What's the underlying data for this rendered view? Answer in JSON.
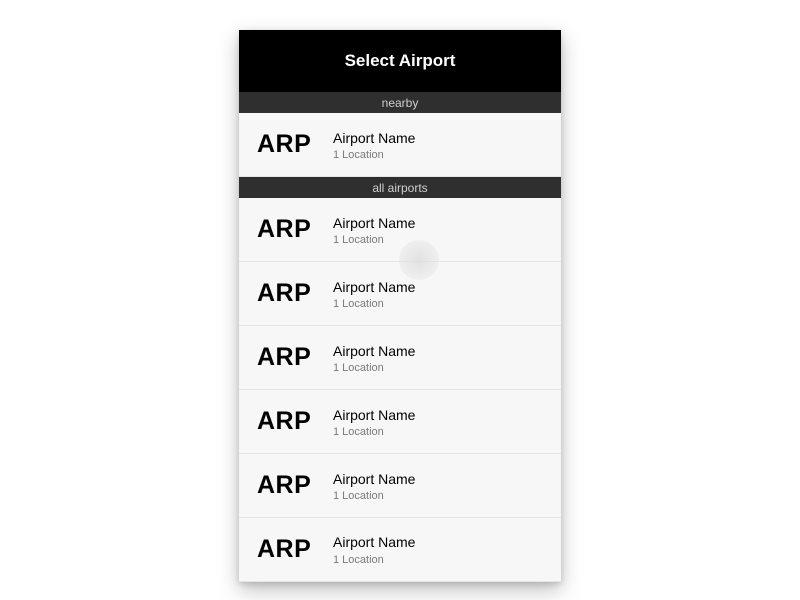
{
  "header": {
    "title": "Select Airport"
  },
  "sections": {
    "nearby": {
      "label": "nearby",
      "items": [
        {
          "code": "ARP",
          "name": "Airport Name",
          "location": "1 Location"
        }
      ]
    },
    "all": {
      "label": "all airports",
      "items": [
        {
          "code": "ARP",
          "name": "Airport Name",
          "location": "1 Location"
        },
        {
          "code": "ARP",
          "name": "Airport Name",
          "location": "1 Location"
        },
        {
          "code": "ARP",
          "name": "Airport Name",
          "location": "1 Location"
        },
        {
          "code": "ARP",
          "name": "Airport Name",
          "location": "1 Location"
        },
        {
          "code": "ARP",
          "name": "Airport Name",
          "location": "1 Location"
        },
        {
          "code": "ARP",
          "name": "Airport Name",
          "location": "1 Location"
        }
      ]
    }
  }
}
